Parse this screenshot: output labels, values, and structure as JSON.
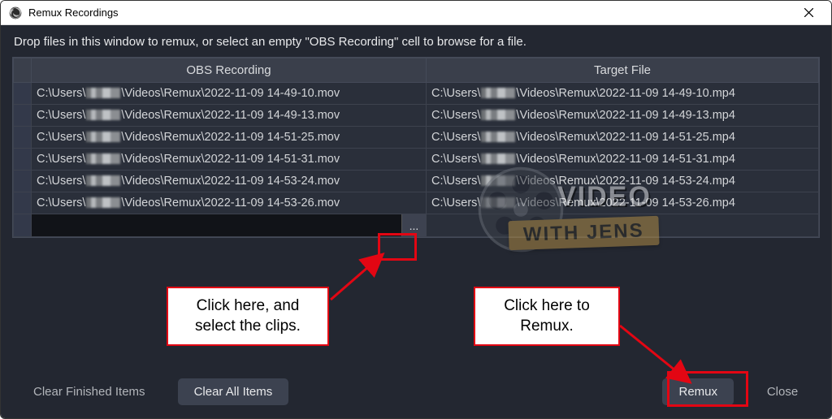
{
  "window": {
    "title": "Remux Recordings",
    "close_icon": "close-icon"
  },
  "instruction": "Drop files in this window to remux, or select an empty \"OBS Recording\" cell to browse for a file.",
  "columns": {
    "obs": "OBS Recording",
    "target": "Target File"
  },
  "path_prefix": "C:\\Users\\",
  "path_mid": "\\Videos\\Remux\\",
  "rows": [
    {
      "obs_tail": "2022-11-09 14-49-10.mov",
      "tgt_tail": "2022-11-09 14-49-10.mp4"
    },
    {
      "obs_tail": "2022-11-09 14-49-13.mov",
      "tgt_tail": "2022-11-09 14-49-13.mp4"
    },
    {
      "obs_tail": "2022-11-09 14-51-25.mov",
      "tgt_tail": "2022-11-09 14-51-25.mp4"
    },
    {
      "obs_tail": "2022-11-09 14-51-31.mov",
      "tgt_tail": "2022-11-09 14-51-31.mp4"
    },
    {
      "obs_tail": "2022-11-09 14-53-24.mov",
      "tgt_tail": "2022-11-09 14-53-24.mp4"
    },
    {
      "obs_tail": "2022-11-09 14-53-26.mov",
      "tgt_tail": "2022-11-09 14-53-26.mp4"
    }
  ],
  "browse_label": "...",
  "buttons": {
    "clear_finished": "Clear Finished Items",
    "clear_all": "Clear All Items",
    "remux": "Remux",
    "close": "Close"
  },
  "annotations": {
    "browse_callout": "Click here, and\nselect the clips.",
    "remux_callout": "Click here to\nRemux."
  },
  "watermark": {
    "line1": "VIDEO",
    "line2": "WITH JENS"
  },
  "colors": {
    "annotation_red": "#e30613",
    "panel_bg": "#232731",
    "table_bg": "#2a2f3a",
    "header_bg": "#3a3f4b",
    "button_bg": "#3c4250"
  }
}
